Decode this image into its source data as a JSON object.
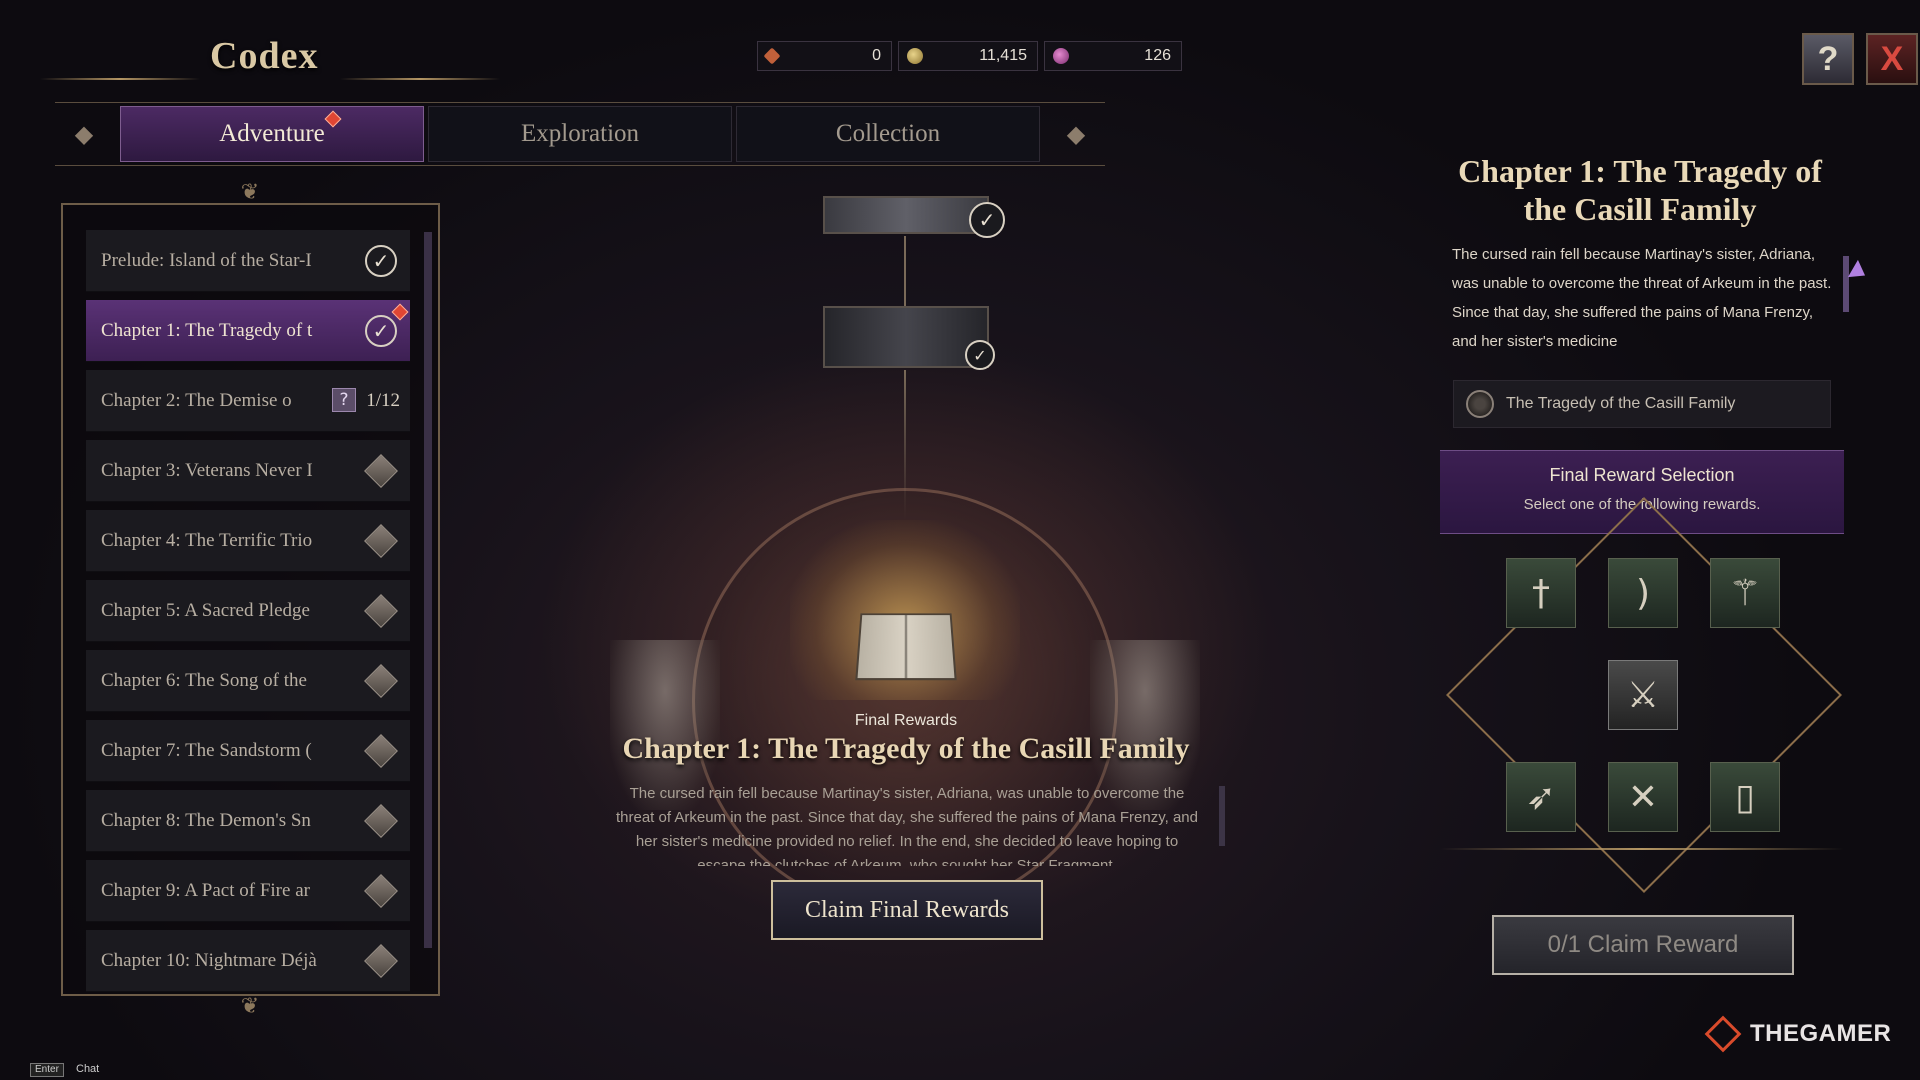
{
  "header": {
    "title": "Codex",
    "currencies": [
      {
        "icon": "ticket-icon",
        "value": "0"
      },
      {
        "icon": "gold-coin-icon",
        "value": "11,415"
      },
      {
        "icon": "gem-icon",
        "value": "126"
      }
    ],
    "help_symbol": "?",
    "close_symbol": "X"
  },
  "tabs": [
    {
      "label": "Adventure",
      "active": true,
      "has_alert": true
    },
    {
      "label": "Exploration",
      "active": false
    },
    {
      "label": "Collection",
      "active": false
    }
  ],
  "chapters": [
    {
      "label": "Prelude: Island of the Star-I",
      "status": "completed"
    },
    {
      "label": "Chapter 1: The Tragedy of t",
      "status": "completed",
      "selected": true,
      "has_alert": true
    },
    {
      "label": "Chapter 2: The Demise o",
      "status": "in-progress",
      "unknown_symbol": "?",
      "progress": "1/12"
    },
    {
      "label": "Chapter 3: Veterans Never I",
      "status": "locked"
    },
    {
      "label": "Chapter 4: The Terrific Trio",
      "status": "locked"
    },
    {
      "label": "Chapter 5: A Sacred Pledge",
      "status": "locked"
    },
    {
      "label": "Chapter 6: The Song of the",
      "status": "locked"
    },
    {
      "label": "Chapter 7: The Sandstorm (",
      "status": "locked"
    },
    {
      "label": "Chapter 8: The Demon's Sn",
      "status": "locked"
    },
    {
      "label": "Chapter 9: A Pact of Fire ar",
      "status": "locked"
    },
    {
      "label": "Chapter 10: Nightmare Déjà",
      "status": "locked"
    }
  ],
  "check_symbol": "✓",
  "center": {
    "final_label": "Final Rewards",
    "final_title": "Chapter 1: The Tragedy of the Casill Family",
    "description": "The cursed rain fell because Martinay's sister, Adriana, was unable to overcome the threat of Arkeum in the past. Since that day, she suffered the pains of Mana Frenzy, and her sister's medicine provided no relief. In the end, she decided to leave hoping to escape the clutches of Arkeum, who sought her Star Fragment.",
    "claim_button": "Claim Final Rewards"
  },
  "right_panel": {
    "title": "Chapter 1: The Tragedy of the Casill Family",
    "description": "The cursed rain fell because Martinay's sister, Adriana, was unable to overcome the threat of Arkeum in the past. Since that day, she suffered the pains of Mana Frenzy, and her sister's medicine",
    "story_entry": "The Tragedy of the Casill Family",
    "reward_header": "Final Reward Selection",
    "reward_subtitle": "Select one of the following rewards.",
    "rewards": [
      {
        "icon": "greatsword-icon",
        "glyph": "†"
      },
      {
        "icon": "longbow-icon",
        "glyph": ")"
      },
      {
        "icon": "staff-icon",
        "glyph": "⚚"
      },
      {
        "icon": "sword-and-shield-icon",
        "glyph": "⚔"
      },
      {
        "icon": "crossbow-icon",
        "glyph": "➶"
      },
      {
        "icon": "dual-daggers-icon",
        "glyph": "✕"
      },
      {
        "icon": "spellbook-icon",
        "glyph": "▯"
      }
    ],
    "claim_button": "0/1 Claim Reward"
  },
  "footer": {
    "key_label": "Enter",
    "chat_label": "Chat"
  },
  "watermark": "THEGAMER"
}
